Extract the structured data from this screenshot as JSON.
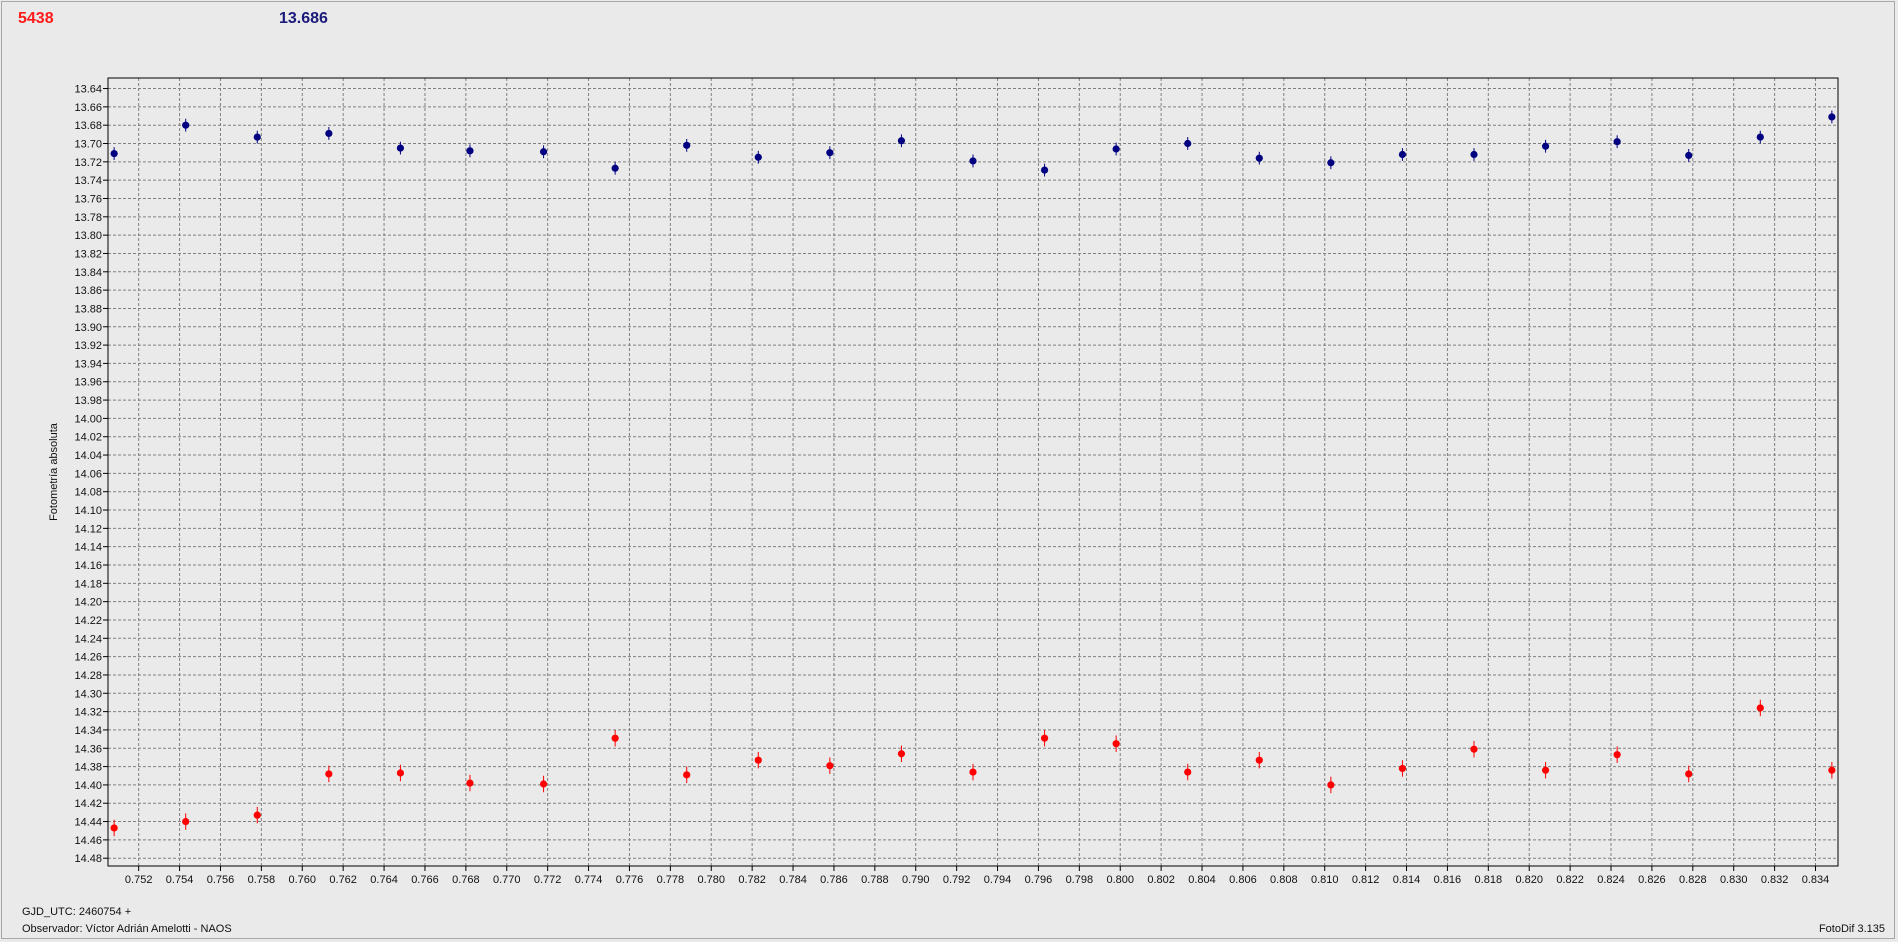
{
  "header": {
    "label_a": "5438",
    "label_b": "13.686"
  },
  "footer": {
    "gjd": "GJD_UTC: 2460754 +",
    "observer": "Observador: Víctor Adrián Amelotti - NAOS",
    "software": "FotoDif 3.135"
  },
  "colors": {
    "series_a": "#ff0000",
    "series_b": "#000080",
    "grid": "#808080",
    "background": "#eaeaea"
  },
  "chart_data": {
    "type": "scatter",
    "title": "",
    "xlabel": "",
    "ylabel": "Fotometría absoluta",
    "xlim": [
      0.7505,
      0.8351
    ],
    "ylim": [
      14.4885,
      13.6285
    ],
    "y_inverted": true,
    "grid": true,
    "x_ticks": [
      "0.752",
      "0.754",
      "0.756",
      "0.758",
      "0.760",
      "0.762",
      "0.764",
      "0.766",
      "0.768",
      "0.770",
      "0.772",
      "0.774",
      "0.776",
      "0.778",
      "0.780",
      "0.782",
      "0.784",
      "0.786",
      "0.788",
      "0.790",
      "0.792",
      "0.794",
      "0.796",
      "0.798",
      "0.800",
      "0.802",
      "0.804",
      "0.806",
      "0.808",
      "0.810",
      "0.812",
      "0.814",
      "0.816",
      "0.818",
      "0.820",
      "0.822",
      "0.824",
      "0.826",
      "0.828",
      "0.830",
      "0.832",
      "0.834"
    ],
    "y_ticks": [
      "13.64",
      "13.66",
      "13.68",
      "13.70",
      "13.72",
      "13.74",
      "13.76",
      "13.78",
      "13.80",
      "13.82",
      "13.84",
      "13.86",
      "13.88",
      "13.90",
      "13.92",
      "13.94",
      "13.96",
      "13.98",
      "14.00",
      "14.02",
      "14.04",
      "14.06",
      "14.08",
      "14.10",
      "14.12",
      "14.14",
      "14.16",
      "14.18",
      "14.20",
      "14.22",
      "14.24",
      "14.26",
      "14.28",
      "14.30",
      "14.32",
      "14.34",
      "14.36",
      "14.38",
      "14.40",
      "14.42",
      "14.44",
      "14.46",
      "14.48"
    ],
    "series": [
      {
        "name": "13.686",
        "color": "#000080",
        "err": 0.007,
        "x": [
          0.7508,
          0.7543,
          0.7578,
          0.7613,
          0.7648,
          0.7682,
          0.7718,
          0.7753,
          0.7788,
          0.7823,
          0.7858,
          0.7893,
          0.7928,
          0.7963,
          0.7998,
          0.8033,
          0.8068,
          0.8103,
          0.8138,
          0.8173,
          0.8208,
          0.8243,
          0.8278,
          0.8313,
          0.8348
        ],
        "y": [
          13.711,
          13.68,
          13.693,
          13.689,
          13.705,
          13.708,
          13.709,
          13.727,
          13.702,
          13.715,
          13.71,
          13.697,
          13.719,
          13.729,
          13.706,
          13.7,
          13.716,
          13.721,
          13.712,
          13.712,
          13.703,
          13.698,
          13.713,
          13.693,
          13.671
        ]
      },
      {
        "name": "5438",
        "color": "#ff0000",
        "err": 0.009,
        "x": [
          0.7508,
          0.7543,
          0.7578,
          0.7613,
          0.7648,
          0.7682,
          0.7718,
          0.7753,
          0.7788,
          0.7823,
          0.7858,
          0.7893,
          0.7928,
          0.7963,
          0.7998,
          0.8033,
          0.8068,
          0.8103,
          0.8138,
          0.8173,
          0.8208,
          0.8243,
          0.8278,
          0.8313,
          0.8348
        ],
        "y": [
          14.447,
          14.44,
          14.433,
          14.388,
          14.387,
          14.398,
          14.399,
          14.349,
          14.389,
          14.373,
          14.379,
          14.366,
          14.386,
          14.349,
          14.355,
          14.386,
          14.373,
          14.4,
          14.382,
          14.361,
          14.384,
          14.367,
          14.388,
          14.316,
          14.384
        ]
      }
    ]
  }
}
